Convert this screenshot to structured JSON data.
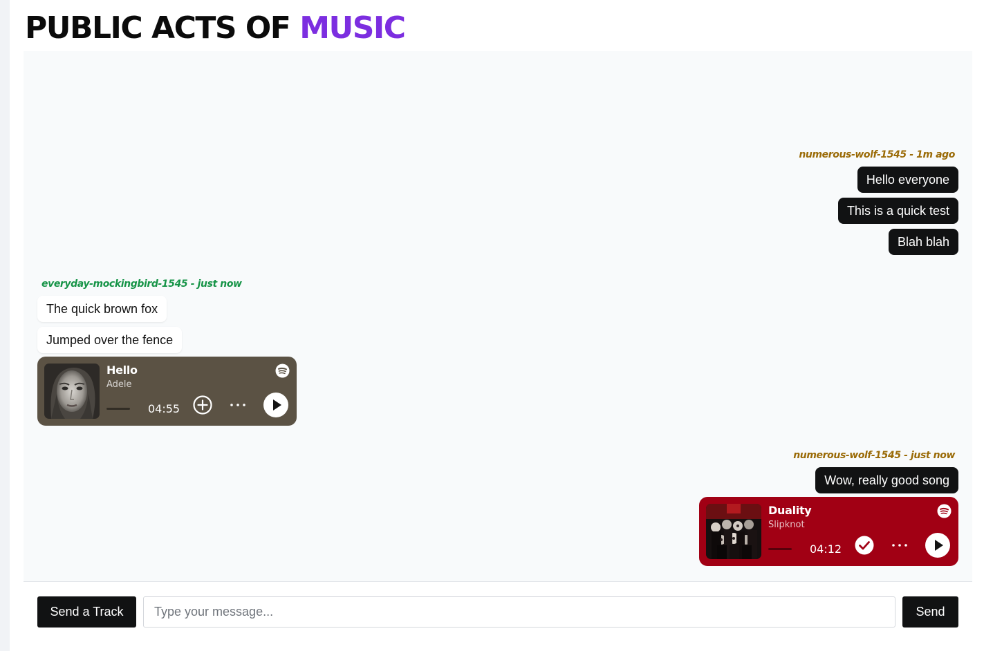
{
  "header": {
    "title_main": "PUBLIC ACTS OF",
    "title_accent": "MUSIC",
    "accent_color": "#7c2ee0"
  },
  "colors": {
    "wolf_name": "#9a6a06",
    "mockingbird_name": "#169447",
    "bubble_dark": "#111213",
    "card_hello": "#5b5244",
    "card_duality": "#a10014"
  },
  "messages": [
    {
      "user": "numerous-wolf-1545",
      "meta": "numerous-wolf-1545 - 1m ago",
      "side": "right",
      "bubbles": [
        "Hello everyone",
        "This is a quick test",
        "Blah blah"
      ]
    },
    {
      "user": "everyday-mockingbird-1545",
      "meta": "everyday-mockingbird-1545 - just now",
      "side": "left",
      "bubbles": [
        "The quick brown fox",
        "Jumped over the fence"
      ],
      "track": {
        "title": "Hello",
        "artist": "Adele",
        "duration": "04:55",
        "progress": 0,
        "saved": false,
        "action_icon": "add-circle-icon",
        "more_icon": "more-horizontal-icon",
        "play_icon": "play-icon",
        "source_icon": "spotify-icon"
      }
    },
    {
      "user": "numerous-wolf-1545",
      "meta": "numerous-wolf-1545 - just now",
      "side": "right",
      "bubbles": [
        "Wow, really good song"
      ],
      "track": {
        "title": "Duality",
        "artist": "Slipknot",
        "duration": "04:12",
        "progress": 0,
        "saved": true,
        "action_icon": "check-circle-icon",
        "more_icon": "more-horizontal-icon",
        "play_icon": "play-icon",
        "source_icon": "spotify-icon"
      }
    }
  ],
  "composer": {
    "send_track_label": "Send a Track",
    "input_value": "",
    "input_placeholder": "Type your message...",
    "send_label": "Send"
  }
}
